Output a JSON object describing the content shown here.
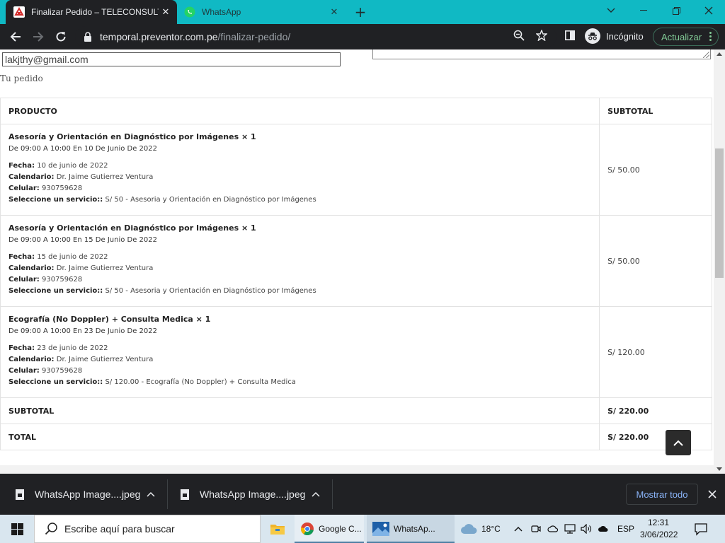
{
  "browser": {
    "tabs": [
      {
        "title": "Finalizar Pedido – TELECONSULTA",
        "active": true
      },
      {
        "title": "WhatsApp",
        "active": false
      }
    ],
    "url_host": "temporal.preventor.com.pe",
    "url_path": "/finalizar-pedido/",
    "incognito_label": "Incógnito",
    "update_label": "Actualizar"
  },
  "page": {
    "email_value": "lakjthy@gmail.com",
    "section_title": "Tu pedido",
    "table": {
      "header_product": "PRODUCTO",
      "header_subtotal": "SUBTOTAL",
      "items": [
        {
          "name": "Asesoría y Orientación en Diagnóstico por Imágenes × 1",
          "schedule": "De 09:00 A 10:00 En 10 De Junio De 2022",
          "fecha_label": "Fecha:",
          "fecha": "10 de junio de 2022",
          "calendario_label": "Calendario:",
          "calendario": "Dr. Jaime Gutierrez Ventura",
          "celular_label": "Celular:",
          "celular": "930759628",
          "servicio_label": "Seleccione un servicio::",
          "servicio": "S/ 50 - Asesoria y Orientación en Diagnóstico por Imágenes",
          "subtotal": "S/ 50.00"
        },
        {
          "name": "Asesoría y Orientación en Diagnóstico por Imágenes × 1",
          "schedule": "De 09:00 A 10:00 En 15 De Junio De 2022",
          "fecha_label": "Fecha:",
          "fecha": "15 de junio de 2022",
          "calendario_label": "Calendario:",
          "calendario": "Dr. Jaime Gutierrez Ventura",
          "celular_label": "Celular:",
          "celular": "930759628",
          "servicio_label": "Seleccione un servicio::",
          "servicio": "S/ 50 - Asesoria y Orientación en Diagnóstico por Imágenes",
          "subtotal": "S/ 50.00"
        },
        {
          "name": "Ecografía (No Doppler) + Consulta Medica × 1",
          "schedule": "De 09:00 A 10:00 En 23 De Junio De 2022",
          "fecha_label": "Fecha:",
          "fecha": "23 de junio de 2022",
          "calendario_label": "Calendario:",
          "calendario": "Dr. Jaime Gutierrez Ventura",
          "celular_label": "Celular:",
          "celular": "930759628",
          "servicio_label": "Seleccione un servicio::",
          "servicio": "S/ 120.00 - Ecografía (No Doppler) + Consulta Medica",
          "subtotal": "S/ 120.00"
        }
      ],
      "subtotal_label": "SUBTOTAL",
      "subtotal_value": "S/ 220.00",
      "total_label": "TOTAL",
      "total_value": "S/ 220.00"
    }
  },
  "downloads": {
    "items": [
      "WhatsApp Image....jpeg",
      "WhatsApp Image....jpeg"
    ],
    "show_all_label": "Mostrar todo"
  },
  "taskbar": {
    "search_placeholder": "Escribe aquí para buscar",
    "apps": [
      "Google C...",
      "WhatsAp..."
    ],
    "temperature": "18°C",
    "language": "ESP",
    "time": "12:31",
    "date": "3/06/2022"
  },
  "colors": {
    "tabstrip": "#10b9c4",
    "chrome_dark": "#202124",
    "update_green": "#81c995",
    "link_blue": "#8ab4f8",
    "taskbar": "#d9e6ef"
  }
}
